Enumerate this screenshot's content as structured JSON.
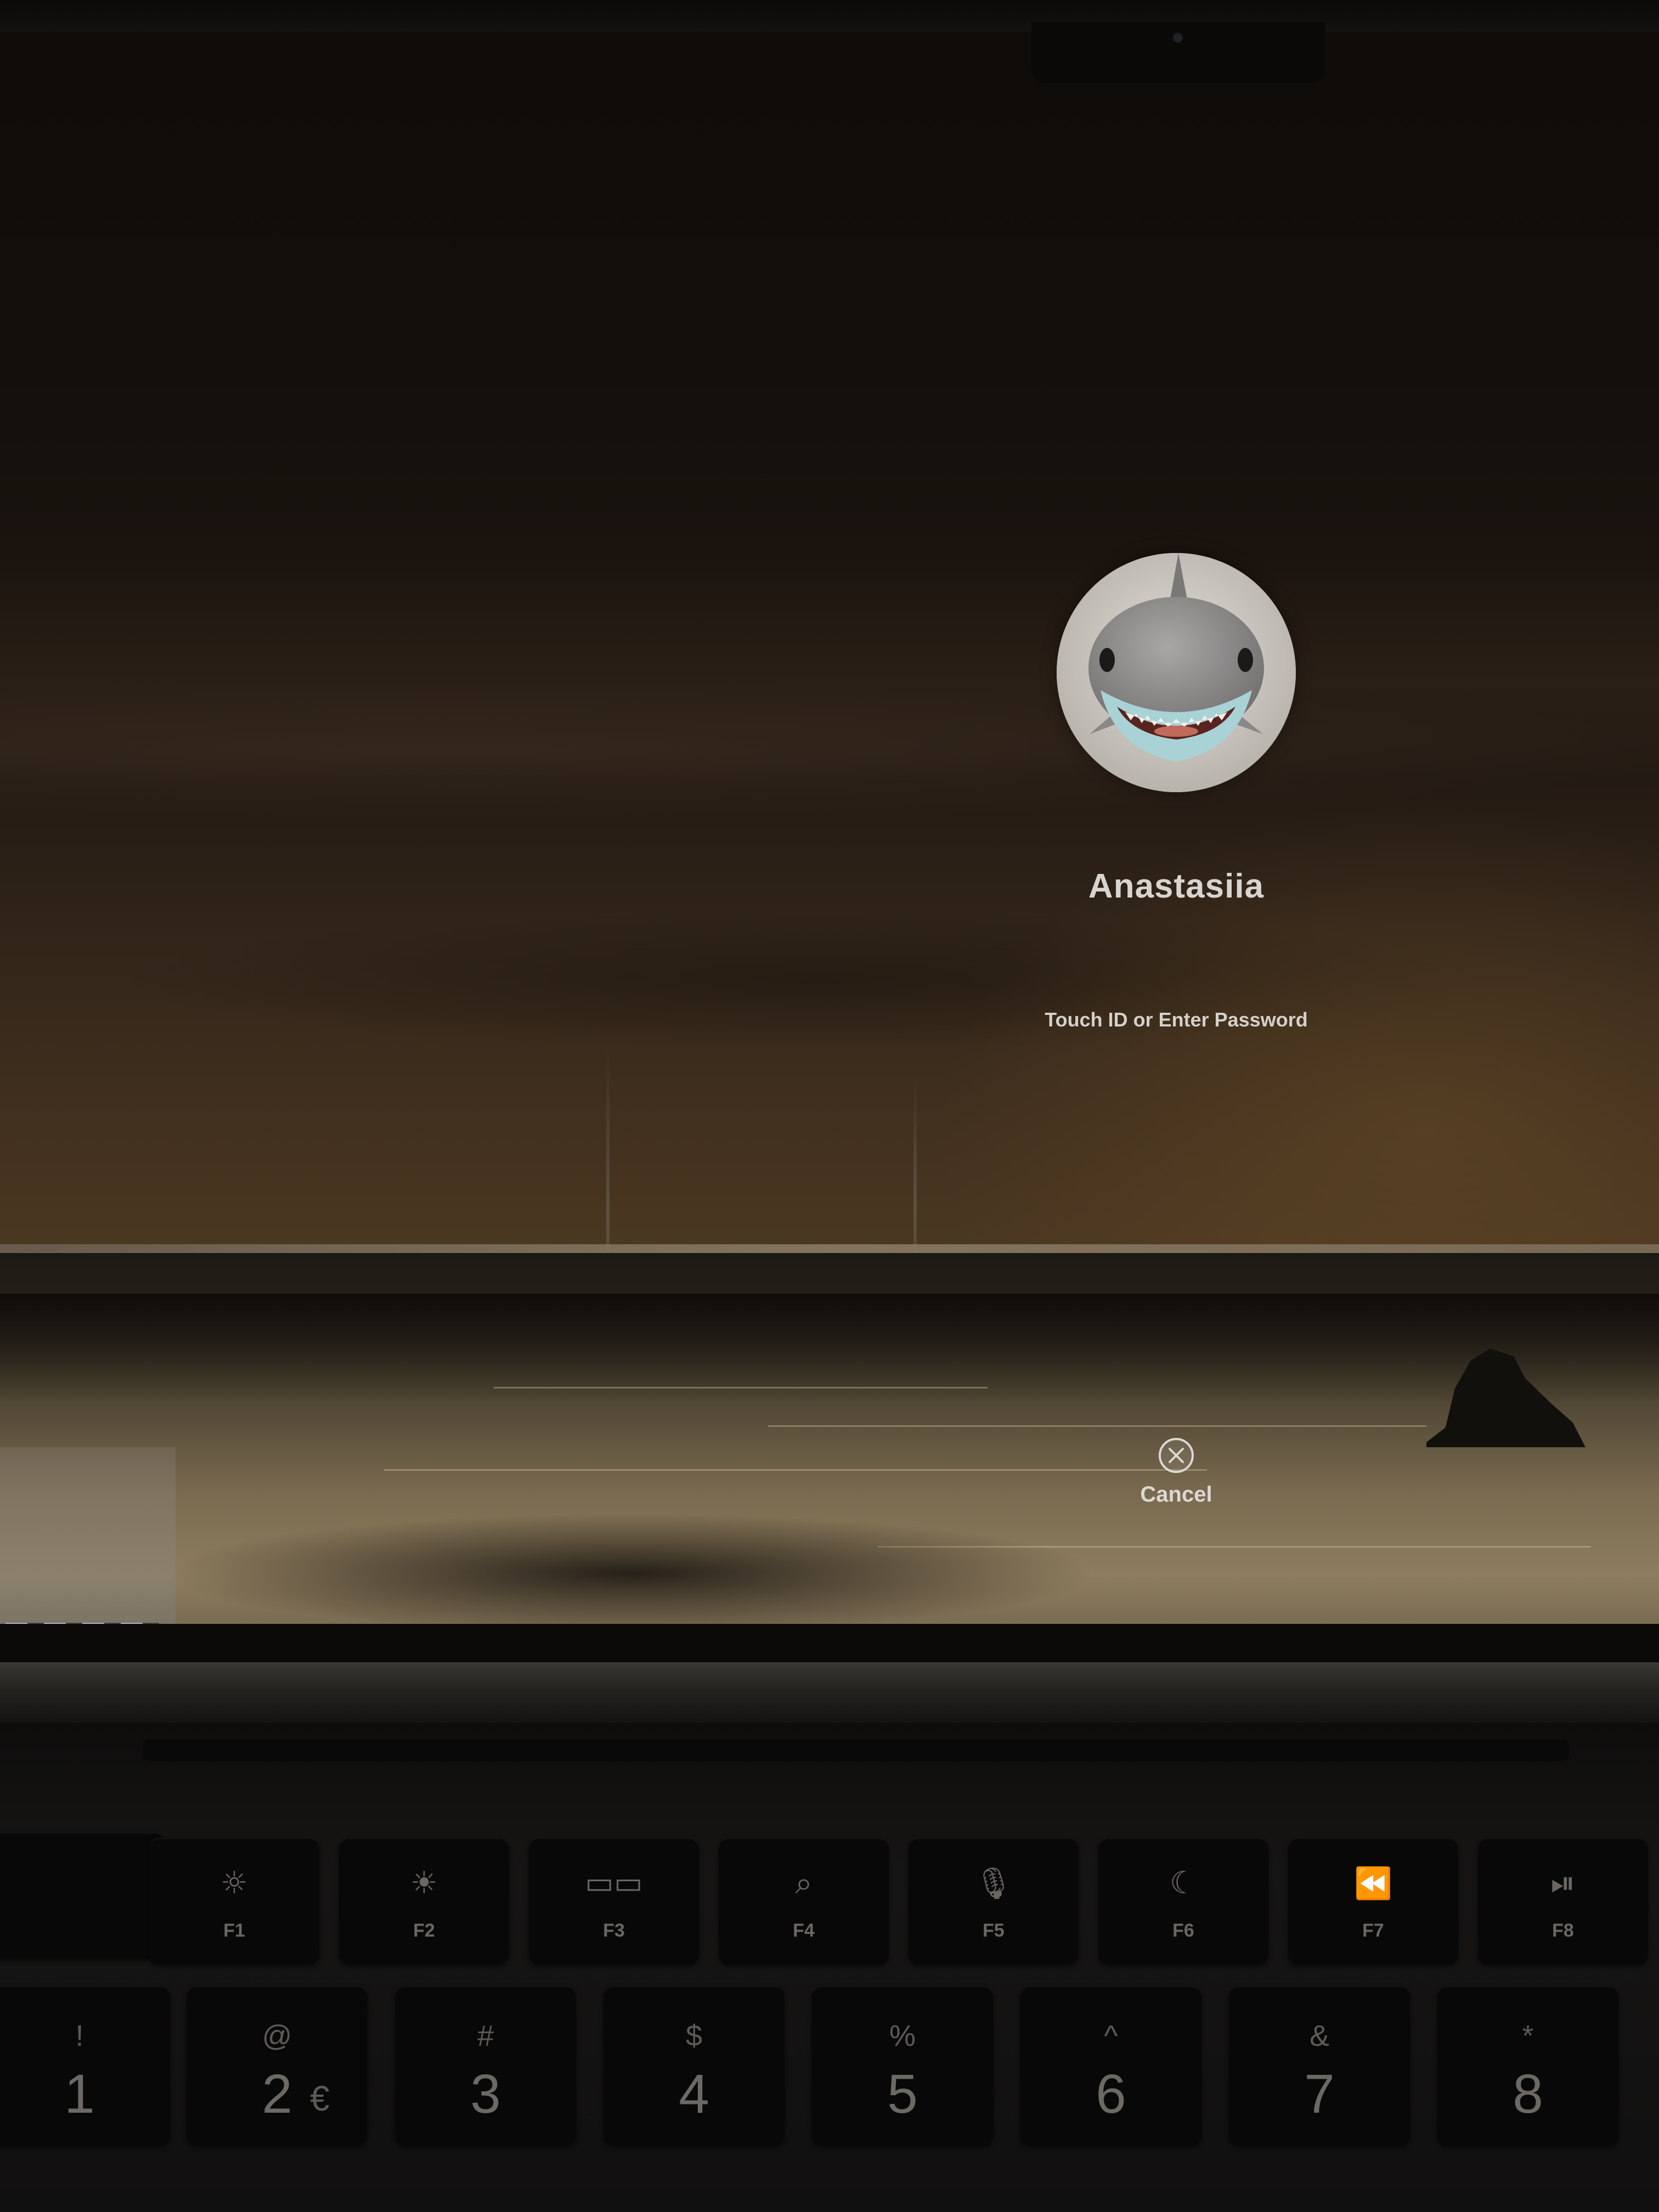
{
  "login": {
    "user_name": "Anastasiia",
    "prompt": "Touch ID or Enter Password",
    "cancel_label": "Cancel",
    "avatar_icon": "shark-memoji-avatar",
    "cancel_icon": "circle-x-icon"
  },
  "keyboard": {
    "function_keys": [
      {
        "label": "F1",
        "icon": "☼",
        "icon_name": "brightness-down-icon"
      },
      {
        "label": "F2",
        "icon": "☀",
        "icon_name": "brightness-up-icon"
      },
      {
        "label": "F3",
        "icon": "▭▭",
        "icon_name": "mission-control-icon"
      },
      {
        "label": "F4",
        "icon": "⌕",
        "icon_name": "spotlight-search-icon"
      },
      {
        "label": "F5",
        "icon": "🎙",
        "icon_name": "dictation-mic-icon"
      },
      {
        "label": "F6",
        "icon": "☾",
        "icon_name": "do-not-disturb-moon-icon"
      },
      {
        "label": "F7",
        "icon": "⏪",
        "icon_name": "rewind-icon"
      },
      {
        "label": "F8",
        "icon": "⏯",
        "icon_name": "play-pause-icon"
      }
    ],
    "number_keys": [
      {
        "shift": "!",
        "main": "1",
        "alt": ""
      },
      {
        "shift": "@",
        "main": "2",
        "alt": "€"
      },
      {
        "shift": "#",
        "main": "3",
        "alt": ""
      },
      {
        "shift": "$",
        "main": "4",
        "alt": ""
      },
      {
        "shift": "%",
        "main": "5",
        "alt": ""
      },
      {
        "shift": "^",
        "main": "6",
        "alt": ""
      },
      {
        "shift": "&",
        "main": "7",
        "alt": ""
      },
      {
        "shift": "*",
        "main": "8",
        "alt": ""
      }
    ]
  },
  "colors": {
    "text": "#d8d4cf",
    "sea_glow": "#8e7d5e"
  }
}
